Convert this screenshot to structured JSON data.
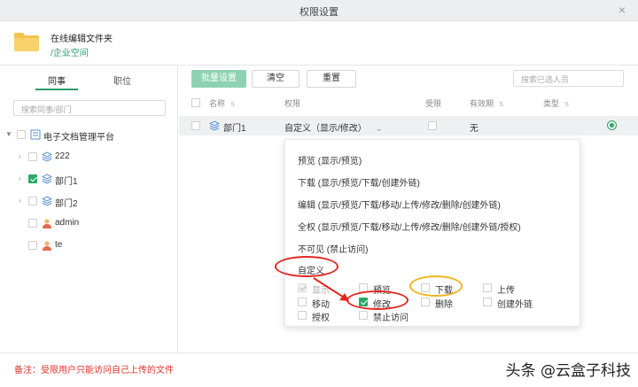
{
  "window": {
    "title": "权限设置",
    "close_glyph": "×"
  },
  "folder": {
    "name": "在线编辑文件夹",
    "path": "/企业空间"
  },
  "left_panel": {
    "tabs": [
      "同事",
      "职位"
    ],
    "search_placeholder": "搜索同事/部门",
    "tree": [
      {
        "label": "电子文档管理平台",
        "checked": false,
        "icon": "org-chart-icon",
        "expandable": true
      },
      {
        "label": "222",
        "checked": false,
        "icon": "layers-icon",
        "expandable": true
      },
      {
        "label": "部门1",
        "checked": true,
        "icon": "layers-icon",
        "expandable": true
      },
      {
        "label": "部门2",
        "checked": false,
        "icon": "layers-icon",
        "expandable": true
      },
      {
        "label": "admin",
        "checked": false,
        "icon": "user-icon",
        "expandable": false
      },
      {
        "label": "te",
        "checked": false,
        "icon": "user-icon",
        "expandable": false
      }
    ]
  },
  "toolbar": {
    "batch_label": "批量设置",
    "clear_label": "清空",
    "reset_label": "重置",
    "search_placeholder": "搜索已选人员"
  },
  "table": {
    "columns": [
      "名称",
      "权限",
      "受限",
      "有效期",
      "类型"
    ],
    "rows": [
      {
        "name": "部门1",
        "permission": "自定义（显示/修改）",
        "restricted": false,
        "expiry": "无"
      }
    ]
  },
  "dropdown": {
    "options": [
      "预览 (显示/预览)",
      "下载 (显示/预览/下载/创建外链)",
      "编辑 (显示/预览/下载/移动/上传/修改/删除/创建外链)",
      "全权 (显示/预览/下载/移动/上传/修改/删除/创建外链/授权)",
      "不可见 (禁止访问)",
      "自定义"
    ],
    "custom_perms": [
      {
        "label": "显示",
        "checked": true,
        "disabled": true
      },
      {
        "label": "预览",
        "checked": false
      },
      {
        "label": "下载",
        "checked": false
      },
      {
        "label": "上传",
        "checked": false
      },
      {
        "label": "移动",
        "checked": false
      },
      {
        "label": "修改",
        "checked": true
      },
      {
        "label": "删除",
        "checked": false
      },
      {
        "label": "创建外链",
        "checked": false
      },
      {
        "label": "授权",
        "checked": false
      },
      {
        "label": "禁止访问",
        "checked": false
      }
    ]
  },
  "footer": {
    "note": "备注：受限用户只能访问自己上传的文件",
    "watermark": "头条 @云盒子科技"
  },
  "colors": {
    "accent": "#2aa86a",
    "primary_button": "#8fd2b3",
    "annotation_red": "#e4261f",
    "annotation_orange": "#f1b321"
  }
}
